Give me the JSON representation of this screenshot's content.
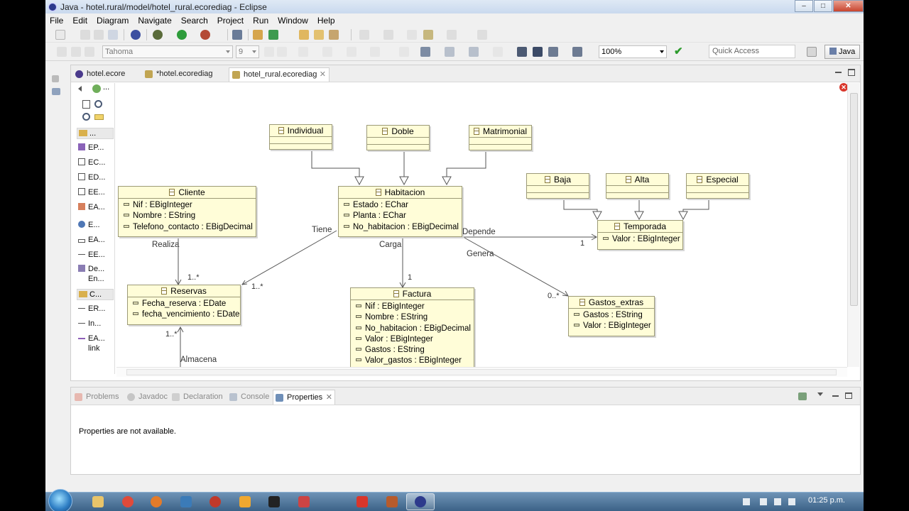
{
  "window": {
    "title": "Java - hotel.rural/model/hotel_rural.ecorediag - Eclipse"
  },
  "menu": [
    "File",
    "Edit",
    "Diagram",
    "Navigate",
    "Search",
    "Project",
    "Run",
    "Window",
    "Help"
  ],
  "toolbar": {
    "font_family": "Tahoma",
    "font_size": "9",
    "zoom": "100%",
    "quick_access_placeholder": "Quick Access",
    "perspective": "Java"
  },
  "editor": {
    "tabs": [
      {
        "label": "hotel.ecore",
        "active": false
      },
      {
        "label": "*hotel.ecorediag",
        "active": false
      },
      {
        "label": "hotel_rural.ecorediag",
        "active": true
      }
    ]
  },
  "palette": {
    "items": [
      {
        "label": "EP...",
        "icon": "epackage-icon"
      },
      {
        "label": "EC...",
        "icon": "eclass-icon"
      },
      {
        "label": "ED...",
        "icon": "edatatype-icon"
      },
      {
        "label": "EE...",
        "icon": "eenum-icon"
      },
      {
        "label": "EA...",
        "icon": "eannotation-icon"
      },
      {
        "label": "E...",
        "icon": "eoperation-icon"
      },
      {
        "label": "EA...",
        "icon": "eattribute-icon"
      },
      {
        "label": "EE...",
        "icon": "eenumliteral-icon"
      },
      {
        "label": "De...",
        "icon": "details-icon"
      },
      {
        "label": "En...",
        "icon": ""
      }
    ],
    "drawer_nodes": "...",
    "drawer_connections": "C...",
    "connections": [
      {
        "label": "ER...",
        "icon": "ereference-icon"
      },
      {
        "label": "In...",
        "icon": "inheritance-icon"
      },
      {
        "label": "EA...",
        "icon": "eannotation-link-icon"
      },
      {
        "label": "link",
        "icon": ""
      }
    ]
  },
  "diagram": {
    "classes": {
      "individual": {
        "name": "Individual",
        "attrs": []
      },
      "doble": {
        "name": "Doble",
        "attrs": []
      },
      "matrimonial": {
        "name": "Matrimonial",
        "attrs": []
      },
      "cliente": {
        "name": "Cliente",
        "attrs": [
          "Nif : EBigInteger",
          "Nombre : EString",
          "Telefono_contacto : EBigDecimal"
        ]
      },
      "habitacion": {
        "name": "Habitacion",
        "attrs": [
          "Estado : EChar",
          "Planta : EChar",
          "No_habitacion : EBigDecimal"
        ]
      },
      "baja": {
        "name": "Baja",
        "attrs": []
      },
      "alta": {
        "name": "Alta",
        "attrs": []
      },
      "especial": {
        "name": "Especial",
        "attrs": []
      },
      "temporada": {
        "name": "Temporada",
        "attrs": [
          "Valor : EBigInteger"
        ]
      },
      "reservas": {
        "name": "Reservas",
        "attrs": [
          "Fecha_reserva : EDate",
          "fecha_vencimiento : EDate"
        ]
      },
      "factura": {
        "name": "Factura",
        "attrs": [
          "Nif : EBigInteger",
          "Nombre : EString",
          "No_habitacion : EBigDecimal",
          "Valor : EBigInteger",
          "Gastos : EString",
          "Valor_gastos : EBigInteger"
        ]
      },
      "gastos_extras": {
        "name": "Gastos_extras",
        "attrs": [
          "Gastos : EString",
          "Valor : EBigInteger"
        ]
      }
    },
    "labels": {
      "tiene": "Tiene",
      "realiza": "Realiza",
      "carga": "Carga",
      "depende": "Depende",
      "genera": "Genera",
      "almacena": "Almacena",
      "mult_realiza": "1..*",
      "mult_tiene": "1..*",
      "mult_carga": "1",
      "mult_depende": "1",
      "mult_genera": "0..*",
      "mult_almacena": "1..*"
    }
  },
  "bottom_panel": {
    "tabs": [
      {
        "label": "Problems",
        "active": false
      },
      {
        "label": "Javadoc",
        "active": false
      },
      {
        "label": "Declaration",
        "active": false
      },
      {
        "label": "Console",
        "active": false
      },
      {
        "label": "Properties",
        "active": true
      }
    ],
    "message": "Properties are not available."
  },
  "taskbar": {
    "clock": "01:25 p.m."
  }
}
